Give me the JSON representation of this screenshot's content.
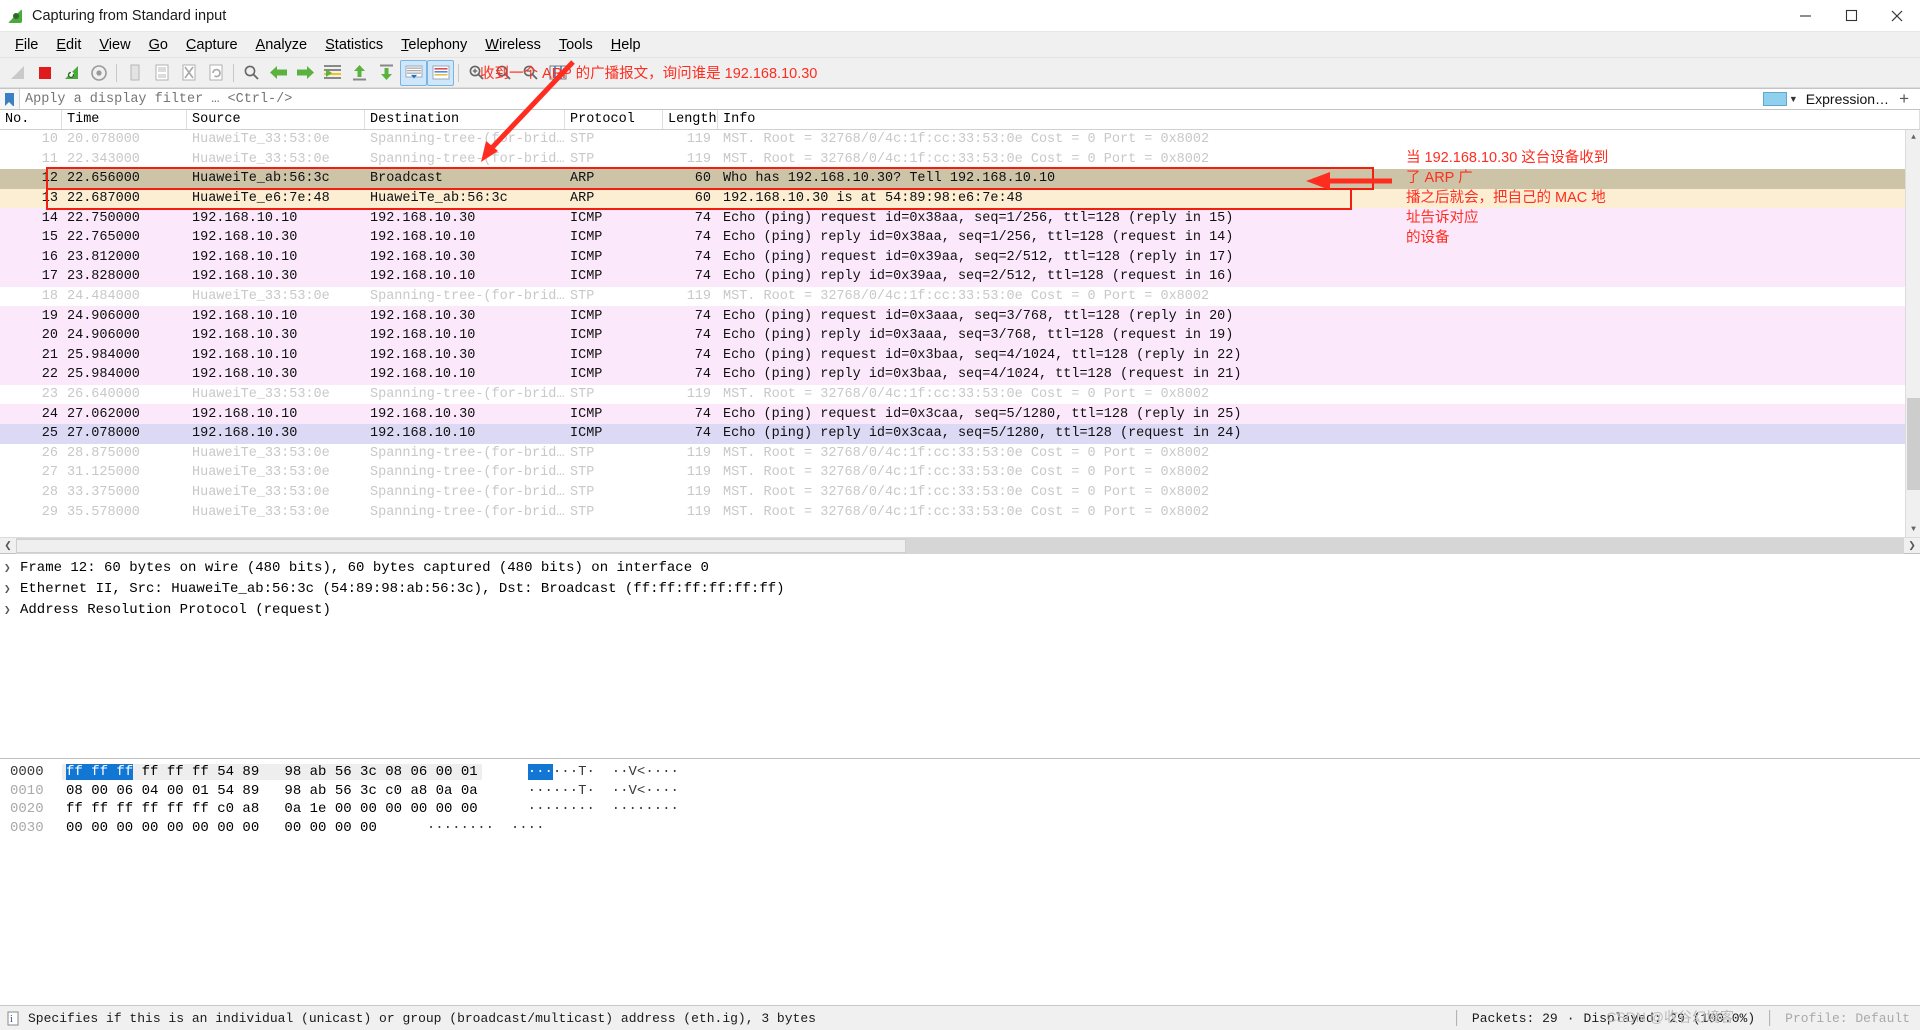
{
  "window": {
    "title": "Capturing from Standard input",
    "icon": "wireshark-icon",
    "minimize": "minimize-icon",
    "maximize": "maximize-icon",
    "close": "close-icon"
  },
  "menubar": {
    "items": [
      {
        "label": "File",
        "mnemonic": "F"
      },
      {
        "label": "Edit",
        "mnemonic": "E"
      },
      {
        "label": "View",
        "mnemonic": "V"
      },
      {
        "label": "Go",
        "mnemonic": "G"
      },
      {
        "label": "Capture",
        "mnemonic": "C"
      },
      {
        "label": "Analyze",
        "mnemonic": "A"
      },
      {
        "label": "Statistics",
        "mnemonic": "S"
      },
      {
        "label": "Telephony",
        "mnemonic": "T"
      },
      {
        "label": "Wireless",
        "mnemonic": "W"
      },
      {
        "label": "Tools",
        "mnemonic": "T"
      },
      {
        "label": "Help",
        "mnemonic": "H"
      }
    ]
  },
  "toolbar": {
    "icons": [
      "start-capture-icon",
      "stop-capture-icon",
      "restart-capture-icon",
      "capture-options-icon",
      "open-file-icon",
      "save-file-icon",
      "close-file-icon",
      "reload-icon",
      "find-packet-icon",
      "go-back-icon",
      "go-forward-icon",
      "go-to-packet-icon",
      "go-first-packet-icon",
      "go-last-packet-icon",
      "auto-scroll-icon",
      "colorize-icon",
      "zoom-in-icon",
      "zoom-out-icon",
      "zoom-reset-icon",
      "resize-columns-icon"
    ],
    "annotation": "收到一个 ARP 的广播报文，询问谁是 192.168.10.30"
  },
  "filter": {
    "bookmark_icon": "filter-bookmark-icon",
    "placeholder": "Apply a display filter … <Ctrl-/>",
    "value": "",
    "expression_label": "Expression…",
    "add_button": "+"
  },
  "packet_list": {
    "columns": [
      "No.",
      "Time",
      "Source",
      "Destination",
      "Protocol",
      "Length",
      "Info"
    ],
    "rows": [
      {
        "no": "10",
        "time": "20.078000",
        "src": "HuaweiTe_33:53:0e",
        "dst": "Spanning-tree-(for-brid…",
        "proto": "STP",
        "len": "119",
        "info": "MST. Root = 32768/0/4c:1f:cc:33:53:0e  Cost = 0  Port = 0x8002",
        "style": "stp"
      },
      {
        "no": "11",
        "time": "22.343000",
        "src": "HuaweiTe_33:53:0e",
        "dst": "Spanning-tree-(for-brid…",
        "proto": "STP",
        "len": "119",
        "info": "MST. Root = 32768/0/4c:1f:cc:33:53:0e  Cost = 0  Port = 0x8002",
        "style": "stp"
      },
      {
        "no": "12",
        "time": "22.656000",
        "src": "HuaweiTe_ab:56:3c",
        "dst": "Broadcast",
        "proto": "ARP",
        "len": "60",
        "info": "Who has 192.168.10.30? Tell 192.168.10.10",
        "style": "arp1"
      },
      {
        "no": "13",
        "time": "22.687000",
        "src": "HuaweiTe_e6:7e:48",
        "dst": "HuaweiTe_ab:56:3c",
        "proto": "ARP",
        "len": "60",
        "info": "192.168.10.30 is at 54:89:98:e6:7e:48",
        "style": "arp2"
      },
      {
        "no": "14",
        "time": "22.750000",
        "src": "192.168.10.10",
        "dst": "192.168.10.30",
        "proto": "ICMP",
        "len": "74",
        "info": "Echo (ping) request  id=0x38aa, seq=1/256, ttl=128 (reply in 15)",
        "style": "icmp"
      },
      {
        "no": "15",
        "time": "22.765000",
        "src": "192.168.10.30",
        "dst": "192.168.10.10",
        "proto": "ICMP",
        "len": "74",
        "info": "Echo (ping) reply    id=0x38aa, seq=1/256, ttl=128 (request in 14)",
        "style": "icmp"
      },
      {
        "no": "16",
        "time": "23.812000",
        "src": "192.168.10.10",
        "dst": "192.168.10.30",
        "proto": "ICMP",
        "len": "74",
        "info": "Echo (ping) request  id=0x39aa, seq=2/512, ttl=128 (reply in 17)",
        "style": "icmp"
      },
      {
        "no": "17",
        "time": "23.828000",
        "src": "192.168.10.30",
        "dst": "192.168.10.10",
        "proto": "ICMP",
        "len": "74",
        "info": "Echo (ping) reply    id=0x39aa, seq=2/512, ttl=128 (request in 16)",
        "style": "icmp"
      },
      {
        "no": "18",
        "time": "24.484000",
        "src": "HuaweiTe_33:53:0e",
        "dst": "Spanning-tree-(for-brid…",
        "proto": "STP",
        "len": "119",
        "info": "MST. Root = 32768/0/4c:1f:cc:33:53:0e  Cost = 0  Port = 0x8002",
        "style": "stp"
      },
      {
        "no": "19",
        "time": "24.906000",
        "src": "192.168.10.10",
        "dst": "192.168.10.30",
        "proto": "ICMP",
        "len": "74",
        "info": "Echo (ping) request  id=0x3aaa, seq=3/768, ttl=128 (reply in 20)",
        "style": "icmp"
      },
      {
        "no": "20",
        "time": "24.906000",
        "src": "192.168.10.30",
        "dst": "192.168.10.10",
        "proto": "ICMP",
        "len": "74",
        "info": "Echo (ping) reply    id=0x3aaa, seq=3/768, ttl=128 (request in 19)",
        "style": "icmp"
      },
      {
        "no": "21",
        "time": "25.984000",
        "src": "192.168.10.10",
        "dst": "192.168.10.30",
        "proto": "ICMP",
        "len": "74",
        "info": "Echo (ping) request  id=0x3baa, seq=4/1024, ttl=128 (reply in 22)",
        "style": "icmp"
      },
      {
        "no": "22",
        "time": "25.984000",
        "src": "192.168.10.30",
        "dst": "192.168.10.10",
        "proto": "ICMP",
        "len": "74",
        "info": "Echo (ping) reply    id=0x3baa, seq=4/1024, ttl=128 (request in 21)",
        "style": "icmp"
      },
      {
        "no": "23",
        "time": "26.640000",
        "src": "HuaweiTe_33:53:0e",
        "dst": "Spanning-tree-(for-brid…",
        "proto": "STP",
        "len": "119",
        "info": "MST. Root = 32768/0/4c:1f:cc:33:53:0e  Cost = 0  Port = 0x8002",
        "style": "stp"
      },
      {
        "no": "24",
        "time": "27.062000",
        "src": "192.168.10.10",
        "dst": "192.168.10.30",
        "proto": "ICMP",
        "len": "74",
        "info": "Echo (ping) request  id=0x3caa, seq=5/1280, ttl=128 (reply in 25)",
        "style": "icmp"
      },
      {
        "no": "25",
        "time": "27.078000",
        "src": "192.168.10.30",
        "dst": "192.168.10.10",
        "proto": "ICMP",
        "len": "74",
        "info": "Echo (ping) reply    id=0x3caa, seq=5/1280, ttl=128 (request in 24)",
        "style": "sel"
      },
      {
        "no": "26",
        "time": "28.875000",
        "src": "HuaweiTe_33:53:0e",
        "dst": "Spanning-tree-(for-brid…",
        "proto": "STP",
        "len": "119",
        "info": "MST. Root = 32768/0/4c:1f:cc:33:53:0e  Cost = 0  Port = 0x8002",
        "style": "stp"
      },
      {
        "no": "27",
        "time": "31.125000",
        "src": "HuaweiTe_33:53:0e",
        "dst": "Spanning-tree-(for-brid…",
        "proto": "STP",
        "len": "119",
        "info": "MST. Root = 32768/0/4c:1f:cc:33:53:0e  Cost = 0  Port = 0x8002",
        "style": "stp"
      },
      {
        "no": "28",
        "time": "33.375000",
        "src": "HuaweiTe_33:53:0e",
        "dst": "Spanning-tree-(for-brid…",
        "proto": "STP",
        "len": "119",
        "info": "MST. Root = 32768/0/4c:1f:cc:33:53:0e  Cost = 0  Port = 0x8002",
        "style": "stp"
      },
      {
        "no": "29",
        "time": "35.578000",
        "src": "HuaweiTe_33:53:0e",
        "dst": "Spanning-tree-(for-brid…",
        "proto": "STP",
        "len": "119",
        "info": "MST. Root = 32768/0/4c:1f:cc:33:53:0e  Cost = 0  Port = 0x8002",
        "style": "stp"
      }
    ]
  },
  "detail_pane": {
    "lines": [
      "Frame 12: 60 bytes on wire (480 bits), 60 bytes captured (480 bits) on interface 0",
      "Ethernet II, Src: HuaweiTe_ab:56:3c (54:89:98:ab:56:3c), Dst: Broadcast (ff:ff:ff:ff:ff:ff)",
      "Address Resolution Protocol (request)"
    ]
  },
  "bytes_pane": {
    "lines": [
      {
        "offset": "0000",
        "hl": "ff ff ff",
        "hex_rest": " ff ff ff 54 89   98 ab 56 3c 08 06 00 01",
        "ascii_hl": "···",
        "ascii_rest": "···T·  ··V<····"
      },
      {
        "offset": "0010",
        "hl": "",
        "hex_rest": "08 00 06 04 00 01 54 89   98 ab 56 3c c0 a8 0a 0a",
        "ascii_hl": "",
        "ascii_rest": "······T·  ··V<····"
      },
      {
        "offset": "0020",
        "hl": "",
        "hex_rest": "ff ff ff ff ff ff c0 a8   0a 1e 00 00 00 00 00 00",
        "ascii_hl": "",
        "ascii_rest": "········  ········"
      },
      {
        "offset": "0030",
        "hl": "",
        "hex_rest": "00 00 00 00 00 00 00 00   00 00 00 00",
        "ascii_hl": "",
        "ascii_rest": "········  ····"
      }
    ]
  },
  "statusbar": {
    "hint_icon": "field-info-icon",
    "hint": "Specifies if this is an individual (unicast) or group (broadcast/multicast) address (eth.ig), 3 bytes",
    "packets": "Packets: 29",
    "sep_dot": "·",
    "displayed": "Displayed: 29 (100.0%)",
    "profile": "Profile: Default",
    "watermark": "CSDN @收谷幻境客"
  },
  "annotations": {
    "top": "收到一个 ARP 的广播报文，询问谁是 192.168.10.30",
    "right_line1": "当 192.168.10.30 这台设备收到了 ARP 广",
    "right_line2": "播之后就会，把自己的 MAC 地址告诉对应",
    "right_line3": "的设备",
    "arrow_color": "#ff2d20",
    "box_color": "#f21e0f"
  }
}
